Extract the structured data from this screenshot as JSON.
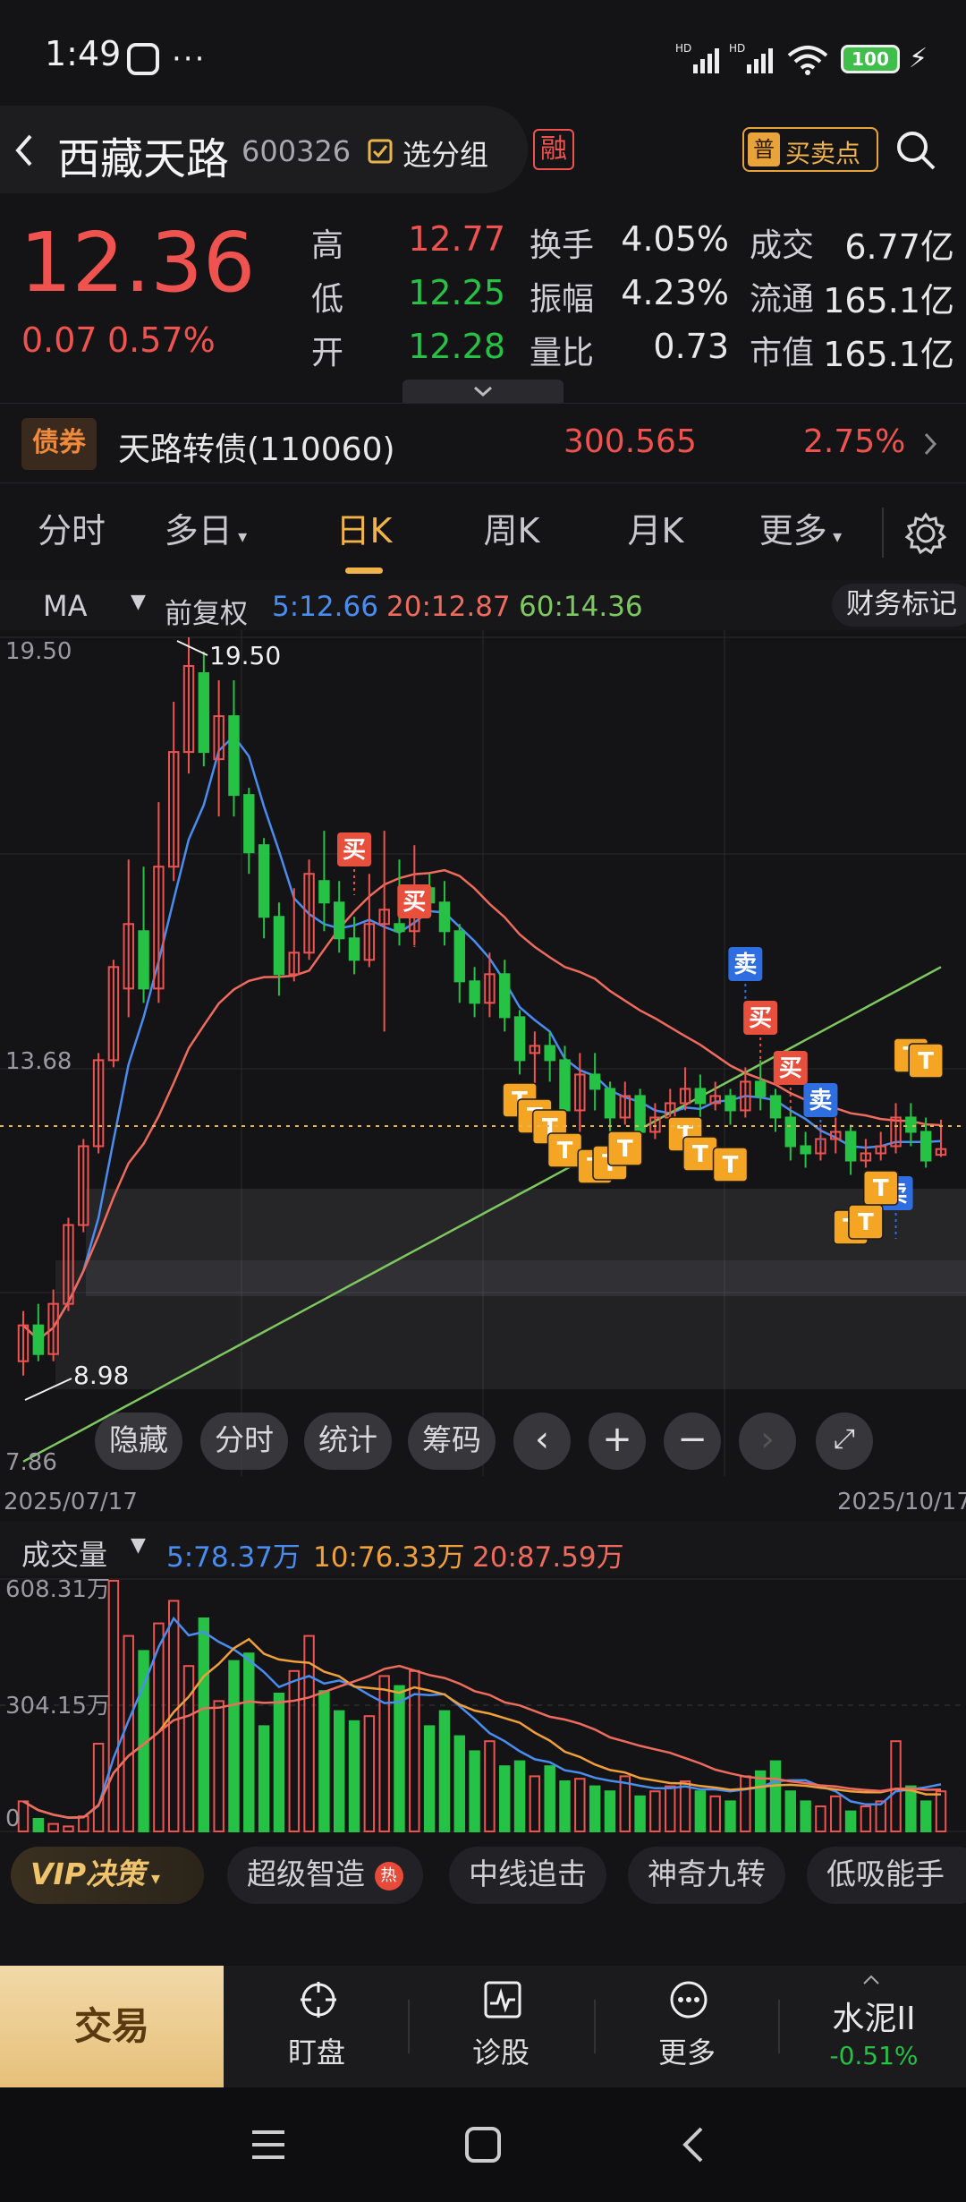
{
  "status_bar": {
    "time": "1:49",
    "battery": "100"
  },
  "header": {
    "stock_name": "西藏天路",
    "stock_code": "600326",
    "watchlist_label": "选分组",
    "margin_badge": "融",
    "buy_sell_badge": "普",
    "buy_sell_label": "买卖点"
  },
  "quote": {
    "price": "12.36",
    "change": "0.07",
    "change_pct": "0.57%",
    "rows": [
      {
        "l1": "高",
        "v1": "12.77",
        "l2": "换手",
        "v2": "4.05%",
        "l3": "成交",
        "v3": "6.77亿"
      },
      {
        "l1": "低",
        "v1": "12.25",
        "l2": "振幅",
        "v2": "4.23%",
        "l3": "流通",
        "v3": "165.1亿"
      },
      {
        "l1": "开",
        "v1": "12.28",
        "l2": "量比",
        "v2": "0.73",
        "l3": "市值",
        "v3": "165.1亿"
      }
    ]
  },
  "bond": {
    "badge": "债券",
    "name": "天路转债(110060)",
    "price": "300.565",
    "change_pct": "2.75%"
  },
  "tabs": [
    "分时",
    "多日",
    "日K",
    "周K",
    "月K",
    "更多"
  ],
  "active_tab": "日K",
  "ma_bar": {
    "selector": "MA",
    "adjust": "前复权",
    "ma5": "5:12.66",
    "ma20": "20:12.87",
    "ma60": "60:14.36",
    "finance_mark": "财务标记"
  },
  "kline": {
    "y_labels": [
      "19.50",
      "13.68",
      "7.86"
    ],
    "high_label": "19.50",
    "low_label": "8.98",
    "start_date": "2025/07/17",
    "end_date": "2025/10/17",
    "signals": {
      "buy": "买",
      "sell": "卖",
      "t": "T"
    }
  },
  "controls": [
    "隐藏",
    "分时",
    "统计",
    "筹码"
  ],
  "volume": {
    "selector": "成交量",
    "ma5": "5:78.37万",
    "ma10": "10:76.33万",
    "ma20": "20:87.59万",
    "y_labels": [
      "608.31万",
      "304.15万",
      "0"
    ]
  },
  "chips": {
    "vip_label": "VIP决策",
    "items": [
      "超级智造",
      "中线追击",
      "神奇九转",
      "低吸能手"
    ],
    "hot_badge": "热"
  },
  "toolbar": {
    "trade": "交易",
    "items": [
      "盯盘",
      "诊股",
      "更多"
    ],
    "sector_name": "水泥II",
    "sector_change": "-0.51%"
  },
  "colors": {
    "up": "#ef5350",
    "down": "#26c245",
    "ma5": "#4a8df0",
    "ma20": "#ef6b5e",
    "ma60": "#7dc85f",
    "accent": "#f0b24a"
  },
  "chart_data": {
    "type": "candlestick",
    "date_range": [
      "2025/07/17",
      "2025/10/17"
    ],
    "ylim": [
      7.86,
      19.5
    ],
    "candles": [
      [
        9.4,
        9.9,
        9.2,
        10.1
      ],
      [
        9.9,
        9.5,
        9.4,
        10.2
      ],
      [
        9.5,
        10.2,
        9.4,
        10.4
      ],
      [
        10.2,
        11.3,
        10.1,
        11.4
      ],
      [
        11.3,
        12.4,
        11.2,
        12.5
      ],
      [
        12.4,
        13.6,
        12.3,
        13.7
      ],
      [
        13.6,
        14.9,
        13.5,
        15.0
      ],
      [
        14.6,
        15.5,
        14.2,
        16.4
      ],
      [
        15.4,
        14.6,
        14.4,
        16.3
      ],
      [
        14.6,
        16.3,
        14.4,
        17.2
      ],
      [
        16.3,
        17.9,
        16.1,
        18.6
      ],
      [
        17.9,
        19.1,
        17.6,
        19.5
      ],
      [
        19.0,
        17.9,
        17.7,
        19.3
      ],
      [
        17.8,
        18.4,
        17.0,
        18.9
      ],
      [
        18.4,
        17.3,
        17.0,
        18.9
      ],
      [
        17.3,
        16.5,
        16.2,
        17.4
      ],
      [
        16.6,
        15.6,
        15.3,
        16.7
      ],
      [
        15.6,
        14.8,
        14.5,
        15.8
      ],
      [
        14.8,
        15.1,
        14.7,
        16.0
      ],
      [
        15.1,
        16.2,
        15.0,
        16.4
      ],
      [
        16.1,
        15.8,
        15.4,
        16.8
      ],
      [
        15.8,
        15.3,
        15.1,
        16.1
      ],
      [
        15.3,
        15.0,
        14.8,
        15.6
      ],
      [
        15.0,
        15.5,
        14.9,
        16.2
      ],
      [
        15.5,
        15.7,
        14.0,
        16.8
      ],
      [
        15.5,
        15.4,
        15.2,
        16.4
      ],
      [
        15.4,
        16.0,
        15.2,
        16.6
      ],
      [
        16.0,
        15.8,
        15.6,
        16.2
      ],
      [
        15.8,
        15.4,
        15.2,
        16.1
      ],
      [
        15.4,
        14.7,
        14.4,
        15.5
      ],
      [
        14.7,
        14.4,
        14.2,
        14.9
      ],
      [
        14.4,
        14.8,
        14.2,
        15.1
      ],
      [
        14.8,
        14.2,
        14.0,
        15.0
      ],
      [
        14.2,
        13.6,
        13.4,
        14.3
      ],
      [
        13.7,
        13.8,
        13.2,
        14.0
      ],
      [
        13.8,
        13.6,
        13.3,
        14.0
      ],
      [
        13.6,
        12.9,
        12.7,
        13.8
      ],
      [
        12.9,
        13.4,
        12.6,
        13.7
      ],
      [
        13.4,
        13.2,
        12.9,
        13.7
      ],
      [
        13.2,
        12.8,
        12.6,
        13.3
      ],
      [
        12.8,
        13.1,
        12.7,
        13.3
      ],
      [
        13.1,
        12.6,
        12.3,
        13.2
      ],
      [
        12.6,
        12.8,
        12.5,
        13.0
      ],
      [
        12.8,
        13.0,
        12.7,
        13.2
      ],
      [
        13.0,
        13.2,
        12.9,
        13.5
      ],
      [
        13.2,
        13.0,
        12.8,
        13.4
      ],
      [
        13.0,
        13.1,
        12.9,
        13.3
      ],
      [
        13.1,
        12.9,
        12.7,
        13.2
      ],
      [
        12.9,
        13.3,
        12.8,
        13.5
      ],
      [
        13.3,
        13.1,
        12.9,
        13.6
      ],
      [
        13.1,
        12.8,
        12.6,
        13.2
      ],
      [
        12.8,
        12.4,
        12.2,
        12.9
      ],
      [
        12.4,
        12.3,
        12.1,
        12.6
      ],
      [
        12.3,
        12.5,
        12.2,
        12.7
      ],
      [
        12.5,
        12.6,
        12.3,
        12.8
      ],
      [
        12.6,
        12.2,
        12.0,
        12.7
      ],
      [
        12.2,
        12.3,
        12.1,
        12.5
      ],
      [
        12.3,
        12.4,
        12.2,
        12.6
      ],
      [
        12.4,
        12.8,
        12.3,
        13.0
      ],
      [
        12.8,
        12.6,
        12.4,
        13.0
      ],
      [
        12.6,
        12.2,
        12.1,
        12.8
      ],
      [
        12.28,
        12.36,
        12.25,
        12.77
      ]
    ]
  }
}
